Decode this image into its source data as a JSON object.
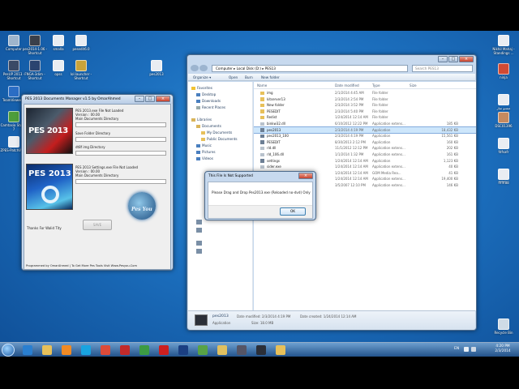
{
  "desktop": {
    "icons_left": [
      {
        "label": "Computer",
        "color": "#9fb5cc"
      },
      {
        "label": "pes2014-1.06 - Shortcut",
        "color": "#3a3f4a"
      },
      {
        "label": "smalla",
        "color": "#e9edf2"
      },
      {
        "label": "pesedit6.0",
        "color": "#e9edf2"
      },
      {
        "label": "PesUP 2013 - Shortcut",
        "color": "#3a4a66"
      },
      {
        "label": "FNGA-3dim - Shortcut",
        "color": "#2b4470"
      },
      {
        "label": "opss",
        "color": "#e9edf2"
      },
      {
        "label": "lol.launcher - Shortcut",
        "color": "#c9a33a"
      },
      {
        "label": "pes2013",
        "color": "#e9edf2"
      },
      {
        "label": "TeamViewer 9",
        "color": "#2b6dc4"
      },
      {
        "label": "Camtasia Studio 7",
        "color": "#4d9d3a"
      },
      {
        "label": "ZPES-PatchV 2.0",
        "color": "#e9edf2"
      }
    ],
    "icons_right": [
      {
        "label": "Nikhil Mahaj - Standings ...",
        "color": "#e9edf2"
      },
      {
        "label": "ninja",
        "color": "#d04a34"
      },
      {
        "label": "منسو سار",
        "color": "#e9edf2"
      },
      {
        "label": "DSC01396",
        "color": "#c58a60"
      },
      {
        "label": "fdfsafr",
        "color": "#e9edf2"
      },
      {
        "label": "ffffff88",
        "color": "#e9edf2"
      },
      {
        "label": "Recycle Bin",
        "color": "#cfdbe6"
      }
    ]
  },
  "pes_manager": {
    "title": "PES 2013 Documents Manager v1.5 by OmarAhmed",
    "section1": {
      "status": "PES 2013.exe File Not Loaded",
      "version": "Version : 00.00",
      "main_dir_label": "Main Documents Directory",
      "save_dir_label": "Save Folder Directory",
      "img_dir_label": "dt8f img Directory",
      "logo_text": "PES 2013"
    },
    "section2": {
      "status": "PES 2013 Settings.exe File Not Loaded",
      "version": "Version : 00.00",
      "main_dir_label": "Main Documents Directory",
      "logo_text": "PES 2013"
    },
    "thanks_label": "Thanks For Walid Tity",
    "save_button": "SAVE",
    "pesyou_logo_text": "Pes You",
    "footer": "Programmed by OmarAhmed | To Get More Pes Tools Visit Www.Pesyou.Com"
  },
  "explorer": {
    "path": [
      "Computer",
      "Local Disk (D:)",
      "PES13"
    ],
    "search_placeholder": "Search PES13",
    "toolbar": {
      "organize": "Organize ▾",
      "open": "Open",
      "burn": "Burn",
      "new_folder": "New folder"
    },
    "columns": [
      "Name",
      "Date modified",
      "Type",
      "Size"
    ],
    "nav": {
      "favorites": "Favorites",
      "desktop": "Desktop",
      "downloads": "Downloads",
      "recent": "Recent Places",
      "libraries": "Libraries",
      "documents": "Documents",
      "my_documents": "My Documents",
      "public_documents": "Public Documents",
      "music": "Music",
      "pictures": "Pictures",
      "videos": "Videos"
    },
    "files": [
      {
        "name": "img",
        "date": "2/1/2014 4:45 AM",
        "type": "File folder",
        "size": "",
        "icon": "folder"
      },
      {
        "name": "kitserver13",
        "date": "2/3/2014 2:54 PM",
        "type": "File folder",
        "size": "",
        "icon": "folder"
      },
      {
        "name": "New folder",
        "date": "2/3/2014 3:52 PM",
        "type": "File folder",
        "size": "",
        "icon": "folder"
      },
      {
        "name": "PESEDIT",
        "date": "2/3/2014 5:40 PM",
        "type": "File folder",
        "size": "",
        "icon": "folder"
      },
      {
        "name": "Redist",
        "date": "1/24/2014 12:14 AM",
        "type": "File folder",
        "size": "",
        "icon": "folder"
      },
      {
        "name": "binkw32.dll",
        "date": "6/10/2012 12:22 PM",
        "type": "Application extens...",
        "size": "185 KB",
        "icon": "dll"
      },
      {
        "name": "pes2013",
        "date": "2/3/2014 4:19 PM",
        "type": "Application",
        "size": "18,432 KB",
        "icon": "exe",
        "selected": true
      },
      {
        "name": "pes2013_100",
        "date": "2/3/2014 4:19 PM",
        "type": "Application",
        "size": "15,561 KB",
        "icon": "exe"
      },
      {
        "name": "PESEDIT",
        "date": "8/30/2013 2:12 PM",
        "type": "Application",
        "size": "160 KB",
        "icon": "exe"
      },
      {
        "name": "rld.dll",
        "date": "11/1/2012 12:12 PM",
        "type": "Application extens...",
        "size": "202 KB",
        "icon": "dll"
      },
      {
        "name": "rld_106.dll",
        "date": "1/1/2014 1:32 PM",
        "type": "Application extens...",
        "size": "161 KB",
        "icon": "dll"
      },
      {
        "name": "settings",
        "date": "1/24/2014 12:14 AM",
        "type": "Application",
        "size": "1,123 KB",
        "icon": "exe"
      },
      {
        "name": "sider.exe",
        "date": "1/24/2014 12:14 AM",
        "type": "Application extens...",
        "size": "40 KB",
        "icon": "dll"
      },
      {
        "name": "sider.log",
        "date": "1/24/2014 12:14 AM",
        "type": "GOM Media Rea...",
        "size": "41 KB",
        "icon": "exe"
      },
      {
        "name": "unins000",
        "date": "1/24/2014 12:14 AM",
        "type": "Application extens...",
        "size": "19,400 KB",
        "icon": "exe"
      },
      {
        "name": "unins000.dat",
        "date": "3/5/2007 12:10 PM",
        "type": "Application extens...",
        "size": "146 KB",
        "icon": "dll"
      }
    ],
    "details": {
      "name": "pes2013",
      "type": "Application",
      "date_modified": "Date modified: 2/3/2014 4:19 PM",
      "size": "Size: 18.0 MB",
      "date_created": "Date created: 1/24/2014 12:14 AM"
    }
  },
  "dialog": {
    "title": "This File Is Not Supported",
    "message": "Please Drag and Drop Pes2013.exe (Reloaded no-dvd) Only",
    "ok": "OK"
  },
  "taskbar": {
    "items": [
      {
        "name": "ie",
        "color": "#2a7fd0"
      },
      {
        "name": "explorer",
        "color": "#e7c05a"
      },
      {
        "name": "media",
        "color": "#f08a24"
      },
      {
        "name": "skype",
        "color": "#18a3e0"
      },
      {
        "name": "chrome",
        "color": "#dd4b39"
      },
      {
        "name": "flash",
        "color": "#c22a2a"
      },
      {
        "name": "chrome2",
        "color": "#3c9b43"
      },
      {
        "name": "opera",
        "color": "#cc1f1f"
      },
      {
        "name": "photoshop",
        "color": "#1b3f82"
      },
      {
        "name": "camtasia",
        "color": "#58a246"
      },
      {
        "name": "folder",
        "color": "#e0c060"
      },
      {
        "name": "pesman",
        "color": "#556"
      },
      {
        "name": "pes",
        "color": "#2b2f38"
      },
      {
        "name": "explorer2",
        "color": "#e7c05a"
      }
    ],
    "lang": "EN",
    "time": "4:20 PM",
    "date": "2/3/2014"
  }
}
